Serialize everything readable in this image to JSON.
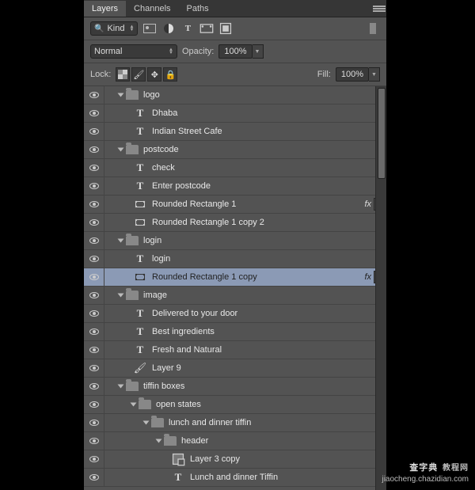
{
  "tabs": {
    "layers": "Layers",
    "channels": "Channels",
    "paths": "Paths"
  },
  "filter": {
    "kind": "Kind"
  },
  "blend": {
    "mode": "Normal",
    "opacityLabel": "Opacity:",
    "opacityValue": "100%"
  },
  "lock": {
    "label": "Lock:",
    "fillLabel": "Fill:",
    "fillValue": "100%"
  },
  "fx": "fx",
  "layers": [
    {
      "eye": true,
      "indent": 0,
      "type": "group",
      "open": true,
      "name": "logo"
    },
    {
      "eye": true,
      "indent": 1,
      "type": "text",
      "name": "Dhaba"
    },
    {
      "eye": true,
      "indent": 1,
      "type": "text",
      "name": "Indian Street Cafe"
    },
    {
      "eye": true,
      "indent": 0,
      "type": "group",
      "open": true,
      "name": "postcode"
    },
    {
      "eye": true,
      "indent": 1,
      "type": "text",
      "name": "check"
    },
    {
      "eye": true,
      "indent": 1,
      "type": "text",
      "name": "Enter postcode"
    },
    {
      "eye": true,
      "indent": 1,
      "type": "shape",
      "name": "Rounded Rectangle 1",
      "fx": true
    },
    {
      "eye": true,
      "indent": 1,
      "type": "shape",
      "name": "Rounded Rectangle 1 copy 2"
    },
    {
      "eye": true,
      "indent": 0,
      "type": "group",
      "open": true,
      "name": "login"
    },
    {
      "eye": true,
      "indent": 1,
      "type": "text",
      "name": "login"
    },
    {
      "eye": true,
      "indent": 1,
      "type": "shape",
      "name": "Rounded Rectangle 1 copy",
      "fx": true,
      "selected": true
    },
    {
      "eye": true,
      "indent": 0,
      "type": "group",
      "open": true,
      "name": "image"
    },
    {
      "eye": true,
      "indent": 1,
      "type": "text",
      "name": "Delivered to your door"
    },
    {
      "eye": true,
      "indent": 1,
      "type": "text",
      "name": "Best ingredients"
    },
    {
      "eye": true,
      "indent": 1,
      "type": "text",
      "name": "Fresh and Natural"
    },
    {
      "eye": true,
      "indent": 1,
      "type": "brush",
      "name": "Layer 9"
    },
    {
      "eye": true,
      "indent": 0,
      "type": "group",
      "open": true,
      "name": "tiffin boxes"
    },
    {
      "eye": true,
      "indent": 1,
      "type": "group",
      "open": true,
      "name": "open states"
    },
    {
      "eye": true,
      "indent": 2,
      "type": "group",
      "open": true,
      "name": "lunch and dinner tiffin"
    },
    {
      "eye": true,
      "indent": 3,
      "type": "group",
      "open": true,
      "name": "header"
    },
    {
      "eye": true,
      "indent": 4,
      "type": "smart",
      "name": "Layer 3 copy"
    },
    {
      "eye": true,
      "indent": 4,
      "type": "text",
      "name": "Lunch and dinner Tiffin"
    }
  ],
  "watermark": {
    "line1": "查字典",
    "line2": "教程网",
    "line3": "jiaocheng.chazidian.com"
  }
}
